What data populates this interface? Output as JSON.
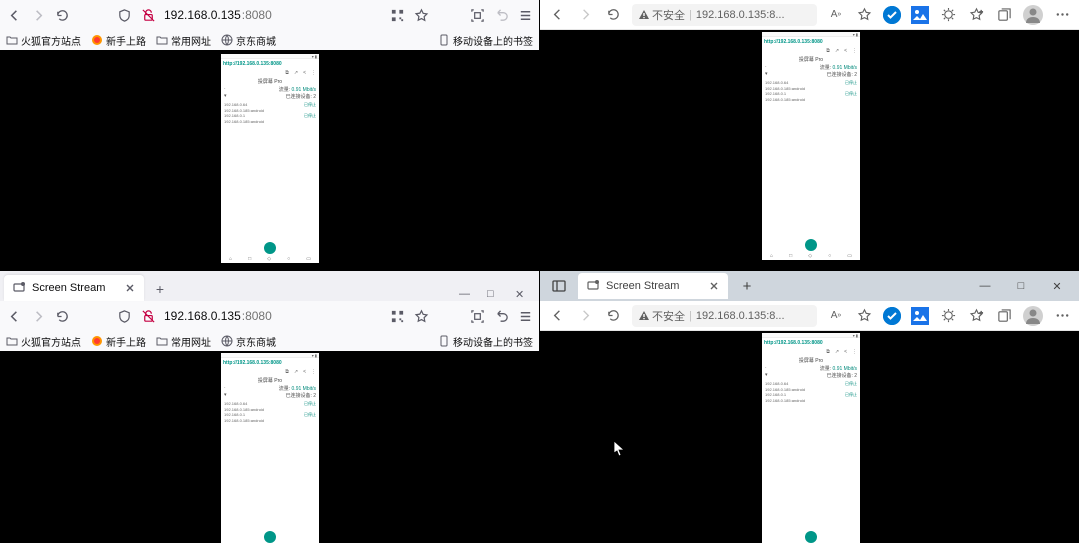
{
  "firefox": {
    "url_host": "192.168.0.135",
    "url_port": ":8080",
    "bookmarks": {
      "b1": "火狐官方站点",
      "b2": "新手上路",
      "b3": "常用网址",
      "b4": "京东商城",
      "mobile": "移动设备上的书签"
    },
    "tab": {
      "title": "Screen Stream",
      "new": "+"
    },
    "win": {
      "min": "—",
      "max": "□",
      "close": "✕"
    }
  },
  "edge": {
    "insecure": "不安全",
    "url": "192.168.0.135:8...",
    "font_btn": "A",
    "tab": {
      "title": "Screen Stream",
      "new": "+"
    },
    "win": {
      "min": "—",
      "max": "□",
      "close": "✕"
    }
  },
  "phone": {
    "status": {
      "time": "",
      "right": "▮"
    },
    "url": "http://192.168.0.135:8080",
    "title": "投屏幕 Pro",
    "rate_label": "流量:",
    "rate_value": "0.91 Mbit/s",
    "conn_label": "已连接设备:",
    "conn_value": "2",
    "ip1": "192.168.0.64",
    "ip2": "192.168.0.185:android",
    "ip3": "192.168.0.1",
    "ip4": "192.168.0.185:android",
    "disc": "已停止",
    "ft": {
      "a": "⌂",
      "b": "□",
      "c": "◇",
      "d": "○",
      "e": "▭"
    }
  }
}
